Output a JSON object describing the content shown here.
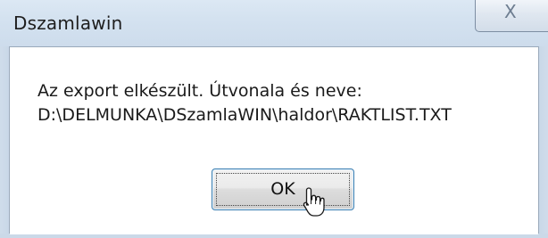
{
  "window": {
    "title": "Dszamlawin",
    "close_icon": "close-icon",
    "close_label": "X"
  },
  "dialog": {
    "message_line1": "Az export elkészült. Útvonala és neve:",
    "message_line2": "D:\\DELMUNKA\\DSzamlaWIN\\haldor\\RAKTLIST.TXT"
  },
  "buttons": {
    "ok_label": "OK"
  },
  "cursor": {
    "icon": "hand-pointer-icon"
  }
}
